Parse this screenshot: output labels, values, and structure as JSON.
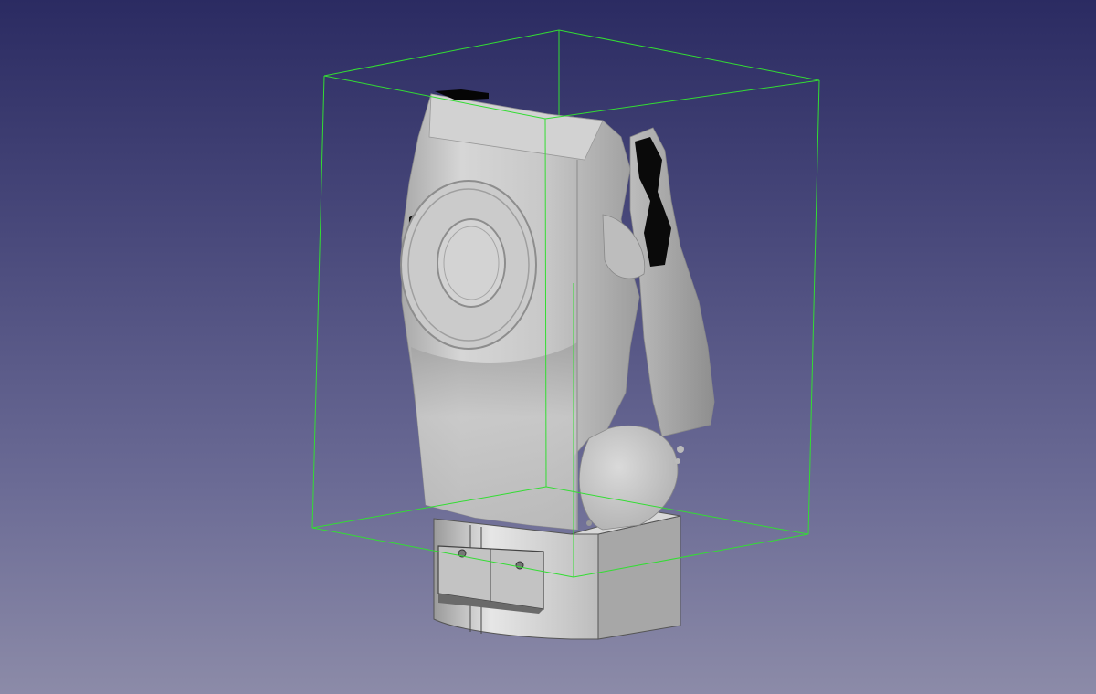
{
  "viewport": {
    "background_top": "#2b2b62",
    "background_bottom": "#8c8ba8"
  },
  "bounding_box": {
    "color": "#33dd33"
  },
  "model": {
    "scan_color": "#c9c9c9",
    "base_color": "#cfcfcf"
  }
}
